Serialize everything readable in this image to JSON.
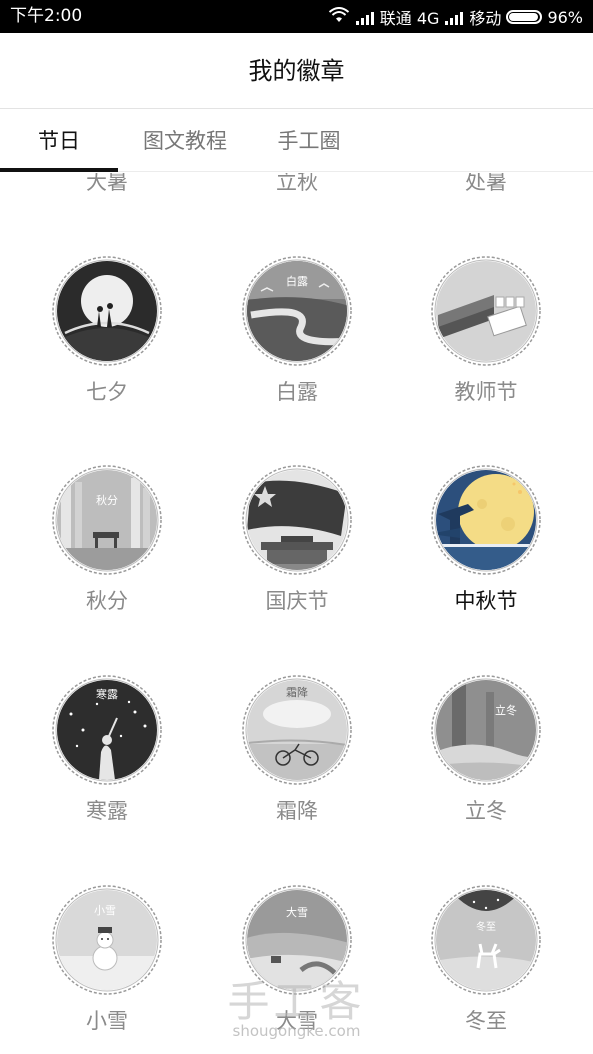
{
  "status_bar": {
    "time": "下午2:00",
    "carrier1": "联通 4G",
    "carrier2": "移动",
    "battery": "96%",
    "battery_level": 0.96
  },
  "header": {
    "title": "我的徽章"
  },
  "tabs": [
    {
      "label": "节日",
      "active": true
    },
    {
      "label": "图文教程",
      "active": false
    },
    {
      "label": "手工圈",
      "active": false
    }
  ],
  "partial_row": [
    "大暑",
    "立秋",
    "处暑"
  ],
  "badges": [
    {
      "label": "七夕",
      "icon": "qixi-badge-icon",
      "active": false
    },
    {
      "label": "白露",
      "icon": "bailu-badge-icon",
      "active": false,
      "text": "白露"
    },
    {
      "label": "教师节",
      "icon": "teachers-day-badge-icon",
      "active": false
    },
    {
      "label": "秋分",
      "icon": "qiufen-badge-icon",
      "active": false,
      "text": "秋分"
    },
    {
      "label": "国庆节",
      "icon": "national-day-badge-icon",
      "active": false
    },
    {
      "label": "中秋节",
      "icon": "mid-autumn-badge-icon",
      "active": true
    },
    {
      "label": "寒露",
      "icon": "hanlu-badge-icon",
      "active": false,
      "text": "寒露"
    },
    {
      "label": "霜降",
      "icon": "shuangjiang-badge-icon",
      "active": false,
      "text": "霜降"
    },
    {
      "label": "立冬",
      "icon": "lidong-badge-icon",
      "active": false,
      "text": "立冬"
    },
    {
      "label": "小雪",
      "icon": "xiaoxue-badge-icon",
      "active": false,
      "text": "小雪"
    },
    {
      "label": "大雪",
      "icon": "daxue-badge-icon",
      "active": false,
      "text": "大雪"
    },
    {
      "label": "冬至",
      "icon": "dongzhi-badge-icon",
      "active": false,
      "text": "冬至"
    }
  ],
  "watermark": {
    "main": "手工客",
    "sub": "shougongke.com"
  },
  "colors": {
    "status_bar_bg": "#000000",
    "text_active": "#111111",
    "text_inactive": "#8a8a8a",
    "tab_indicator": "#111111",
    "moon_yellow": "#f4dc86",
    "night_blue": "#2c4f7c"
  }
}
